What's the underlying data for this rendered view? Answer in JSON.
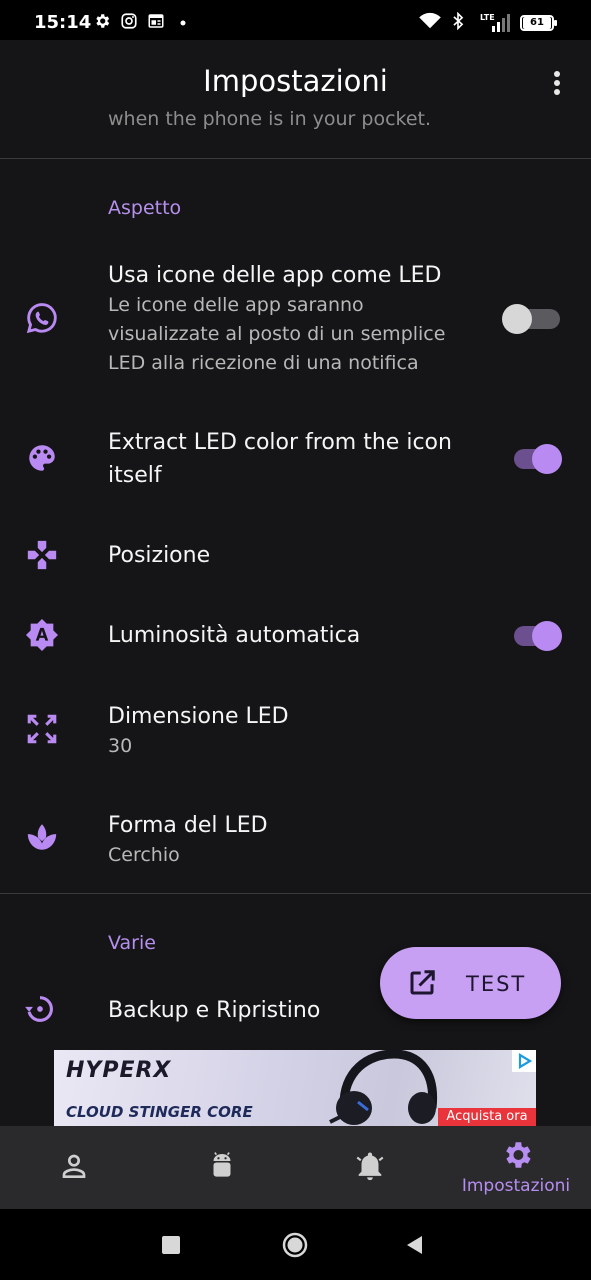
{
  "status_bar": {
    "time": "15:14",
    "battery": "61",
    "network": "LTE",
    "icons": [
      "gear-icon",
      "instagram-icon",
      "news-icon",
      "dot-icon",
      "wifi-icon",
      "bluetooth-icon",
      "signal-icon",
      "battery-icon"
    ]
  },
  "app_bar": {
    "title": "Impostazioni",
    "ghost_text": "when the phone is in your pocket."
  },
  "sections": {
    "aspetto": "Aspetto",
    "varie": "Varie"
  },
  "rows": {
    "app_icons": {
      "title": "Usa icone delle app come LED",
      "subtitle": "Le icone delle app saranno visualizzate al posto di un semplice LED alla ricezione di una notifica",
      "enabled": false,
      "icon": "whatsapp-icon"
    },
    "extract_color": {
      "title": "Extract LED color from the icon itself",
      "enabled": true,
      "icon": "palette-icon"
    },
    "position": {
      "title": "Posizione",
      "icon": "gamepad-icon"
    },
    "auto_brightness": {
      "title": "Luminosità automatica",
      "enabled": true,
      "icon": "brightness-auto-icon"
    },
    "led_size": {
      "title": "Dimensione LED",
      "value": "30",
      "icon": "expand-icon"
    },
    "led_shape": {
      "title": "Forma del LED",
      "value": "Cerchio",
      "icon": "spa-icon"
    },
    "backup": {
      "title": "Backup e Ripristino",
      "icon": "backup-restore-icon"
    }
  },
  "fab": {
    "label": "TEST",
    "icon": "open-in-new-icon"
  },
  "ad": {
    "brand": "HYPERX",
    "product": "CLOUD STINGER CORE",
    "cta": "Acquista ora"
  },
  "bottom_nav": {
    "items": [
      {
        "icon": "person-icon"
      },
      {
        "icon": "android-icon"
      },
      {
        "icon": "bell-icon"
      },
      {
        "icon": "gear-icon",
        "label": "Impostazioni",
        "active": true
      }
    ]
  },
  "colors": {
    "accent": "#b98af2",
    "background": "#151416",
    "nav_background": "#2a292c"
  }
}
